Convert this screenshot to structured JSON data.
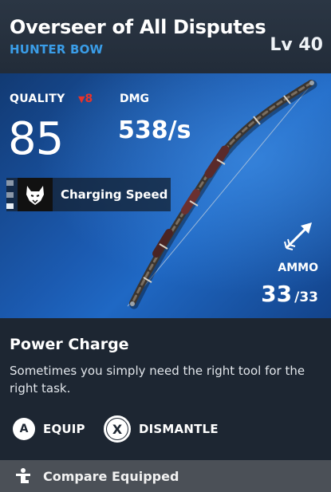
{
  "header": {
    "item_name": "Overseer of All Disputes",
    "item_type": "HUNTER BOW",
    "level": "Lv 40"
  },
  "stats": {
    "quality_label": "QUALITY",
    "quality_delta": "8",
    "quality_delta_icon": "down-triangle-icon",
    "quality_value": "85",
    "dmg_label": "DMG",
    "dmg_value": "538/s"
  },
  "perk": {
    "label": "Charging Speed",
    "icon": "wolf-head-icon",
    "level_filled": 1,
    "level_total": 3
  },
  "ammo": {
    "icon": "arrow-icon",
    "label": "AMMO",
    "current": "33",
    "max": "/33"
  },
  "ability": {
    "name": "Power Charge",
    "description": "Sometimes you simply need the right tool for the right task."
  },
  "actions": {
    "equip_key": "A",
    "equip_label": "EQUIP",
    "dismantle_key": "X",
    "dismantle_label": "DISMANTLE"
  },
  "footer": {
    "compare_label": "Compare Equipped",
    "compare_icon": "compare-figure-icon"
  },
  "colors": {
    "item_type": "#3a9de8",
    "quality_delta": "#e8332a",
    "hero_blue": "#1b5ab0",
    "background": "#1d2632",
    "footer": "#4b5057"
  }
}
